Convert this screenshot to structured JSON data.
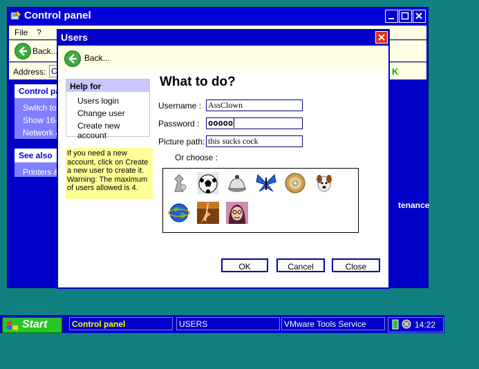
{
  "control_panel": {
    "title": "Control panel",
    "menu": {
      "file": "File",
      "help": "?"
    },
    "back_label": "Back...",
    "address_label": "Address:",
    "address_value": "C",
    "partial_right_text": "K",
    "left_panel": {
      "section1_title": "Control pa",
      "links": [
        "Switch to c",
        "Show 16-b",
        "Network &"
      ],
      "section2_title": "See also",
      "see_also_links": [
        "Printers & I"
      ]
    },
    "maintenance_text": "tenance"
  },
  "users_dialog": {
    "title": "Users",
    "back_label": "Back...",
    "help_title": "Help for",
    "help_links": [
      "Users login",
      "Change user",
      "Create new account"
    ],
    "warning_text": "If you need a new account, click on Create a new user to create it. Warning: The maximum of users allowed is 4.",
    "heading": "What to do?",
    "username_label": "Username :",
    "username_value": "AssClown",
    "password_label": "Password :",
    "password_value": "ooooo",
    "picture_label": "Picture path:",
    "picture_value": "this sucks cock",
    "or_choose_label": "Or choose :",
    "pictures": [
      "chess-piece",
      "soccer-ball",
      "bell",
      "butterfly",
      "cd",
      "dog",
      "globe",
      "guitar",
      "woman"
    ],
    "buttons": {
      "ok": "OK",
      "cancel": "Cancel",
      "close": "Close"
    }
  },
  "taskbar": {
    "start_label": "Start",
    "items": [
      "Control panel",
      "USERS",
      "VMware Tools Service"
    ],
    "clock": "14:22"
  },
  "colors": {
    "desktop": "#108080",
    "window_blue": "#0000c8",
    "toolbar_bg": "#ffffe6",
    "help_header": "#c8c8ff",
    "warning_bg": "#ffff96",
    "start_green": "#26c826",
    "close_red": "#e0301e"
  }
}
